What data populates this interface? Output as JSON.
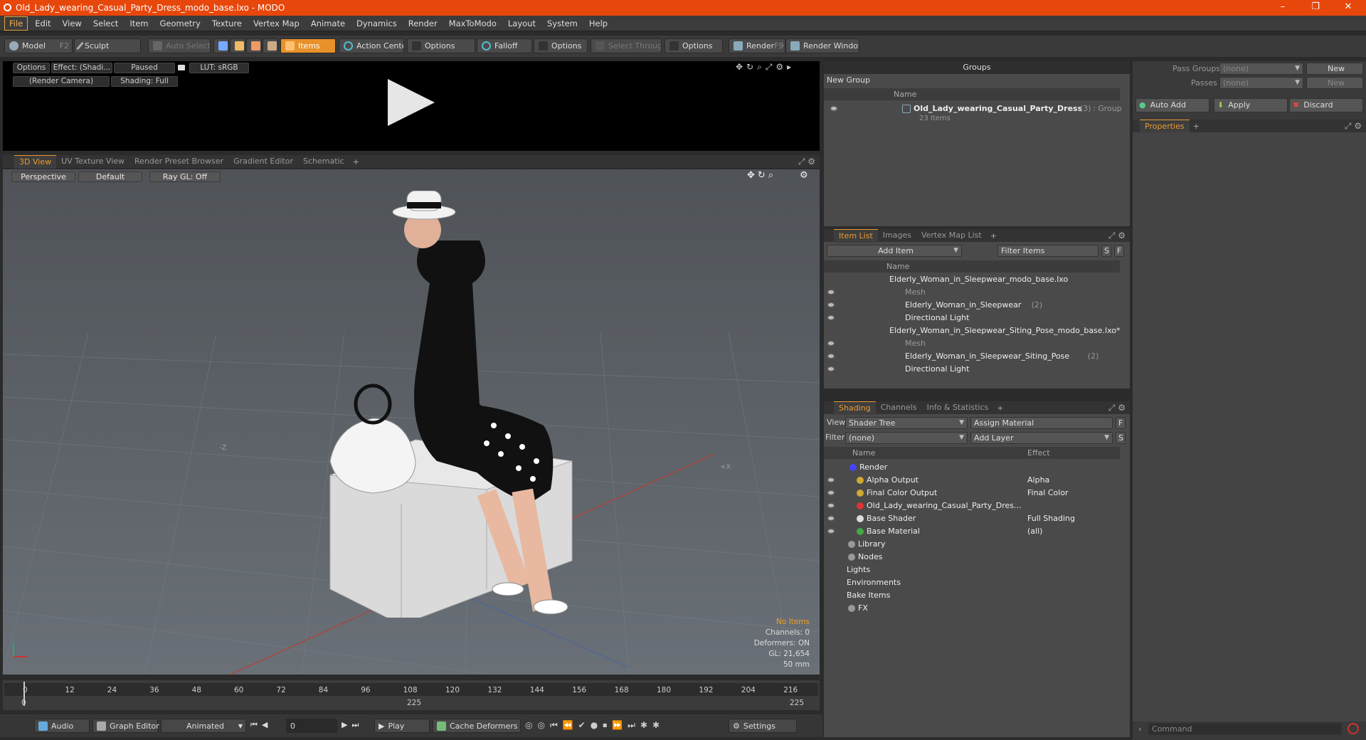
{
  "window": {
    "title": "Old_Lady_wearing_Casual_Party_Dress_modo_base.lxo - MODO",
    "minimize": "–",
    "maximize": "❐",
    "close": "✕"
  },
  "menu": [
    "File",
    "Edit",
    "View",
    "Select",
    "Item",
    "Geometry",
    "Texture",
    "Vertex Map",
    "Animate",
    "Dynamics",
    "Render",
    "MaxToModo",
    "Layout",
    "System",
    "Help"
  ],
  "toolbar": {
    "model": "Model",
    "model_key": "F2",
    "sculpt": "Sculpt",
    "auto_select": "Auto Select",
    "items": "Items",
    "action_center": "Action Center",
    "options1": "Options",
    "falloff": "Falloff",
    "options2": "Options",
    "select_through": "Select Through",
    "options3": "Options",
    "render": "Render",
    "render_key": "F9",
    "render_window": "Render Window"
  },
  "preview": {
    "options": "Options",
    "effect": "Effect: (Shadi...",
    "paused": "Paused",
    "lut": "LUT: sRGB",
    "camera": "(Render Camera)",
    "shading": "Shading: Full"
  },
  "viewport_tabs": [
    "3D View",
    "UV Texture View",
    "Render Preset Browser",
    "Gradient Editor",
    "Schematic",
    "+"
  ],
  "viewport": {
    "perspective": "Perspective",
    "default": "Default",
    "raygl": "Ray GL: Off",
    "axis_z": "-Z",
    "axis_x": "+X",
    "hud": {
      "no_items": "No Items",
      "channels": "Channels: 0",
      "deformers": "Deformers: ON",
      "gl": "GL: 21,654",
      "focal": "50 mm"
    }
  },
  "timeline": {
    "ticks": [
      "0",
      "12",
      "24",
      "36",
      "48",
      "60",
      "72",
      "84",
      "96",
      "108",
      "120",
      "132",
      "144",
      "156",
      "168",
      "180",
      "192",
      "204",
      "216"
    ],
    "start": "0",
    "mid": "225",
    "end": "225"
  },
  "bottom": {
    "audio": "Audio",
    "graph_editor": "Graph Editor",
    "animated": "Animated",
    "frame": "0",
    "play": "Play",
    "cache": "Cache Deformers",
    "settings": "Settings"
  },
  "groups": {
    "title": "Groups",
    "new_group": "New Group",
    "col_name": "Name",
    "item_name": "Old_Lady_wearing_Casual_Party_Dress",
    "item_count": "(3)",
    "item_type": ": Group",
    "item_sub": "23 Items"
  },
  "itemlist": {
    "tabs": [
      "Item List",
      "Images",
      "Vertex Map List",
      "+"
    ],
    "add_item": "Add Item",
    "filter": "Filter Items",
    "s": "S",
    "f": "F",
    "col_name": "Name",
    "rows": [
      {
        "label": "Elderly_Woman_in_Sleepwear_modo_base.lxo",
        "extra": "",
        "dim": false
      },
      {
        "label": "Mesh",
        "extra": "",
        "dim": true
      },
      {
        "label": "Elderly_Woman_in_Sleepwear",
        "extra": "(2)",
        "dim": false
      },
      {
        "label": "Directional Light",
        "extra": "",
        "dim": false
      },
      {
        "label": "Elderly_Woman_in_Sleepwear_Siting_Pose_modo_base.lxo*",
        "extra": "",
        "dim": false
      },
      {
        "label": "Mesh",
        "extra": "",
        "dim": true
      },
      {
        "label": "Elderly_Woman_in_Sleepwear_Siting_Pose",
        "extra": "(2)",
        "dim": false
      },
      {
        "label": "Directional Light",
        "extra": "",
        "dim": false
      }
    ]
  },
  "shading": {
    "tabs": [
      "Shading",
      "Channels",
      "Info & Statistics",
      "+"
    ],
    "view_label": "View",
    "view_value": "Shader Tree",
    "assign": "Assign Material",
    "f": "F",
    "filter_label": "Filter",
    "filter_value": "(none)",
    "add_layer": "Add Layer",
    "s": "S",
    "col_name": "Name",
    "col_effect": "Effect",
    "rows": [
      {
        "label": "Render",
        "effect": ""
      },
      {
        "label": "Alpha Output",
        "effect": "Alpha"
      },
      {
        "label": "Final Color Output",
        "effect": "Final Color"
      },
      {
        "label": "Old_Lady_wearing_Casual_Party_Dres...",
        "effect": ""
      },
      {
        "label": "Base Shader",
        "effect": "Full Shading"
      },
      {
        "label": "Base Material",
        "effect": "(all)"
      },
      {
        "label": "Library",
        "effect": ""
      },
      {
        "label": "Nodes",
        "effect": ""
      },
      {
        "label": "Lights",
        "effect": ""
      },
      {
        "label": "Environments",
        "effect": ""
      },
      {
        "label": "Bake Items",
        "effect": ""
      },
      {
        "label": "FX",
        "effect": ""
      }
    ]
  },
  "right": {
    "pass_groups": "Pass Groups",
    "passes": "Passes",
    "none1": "(none)",
    "none2": "(none)",
    "new1": "New",
    "new2": "New",
    "auto_add": "Auto Add",
    "apply": "Apply",
    "discard": "Discard",
    "properties": "Properties",
    "plus": "+",
    "command": "Command"
  },
  "colors": {
    "accent": "#e8470c",
    "highlight": "#ea9a30"
  }
}
